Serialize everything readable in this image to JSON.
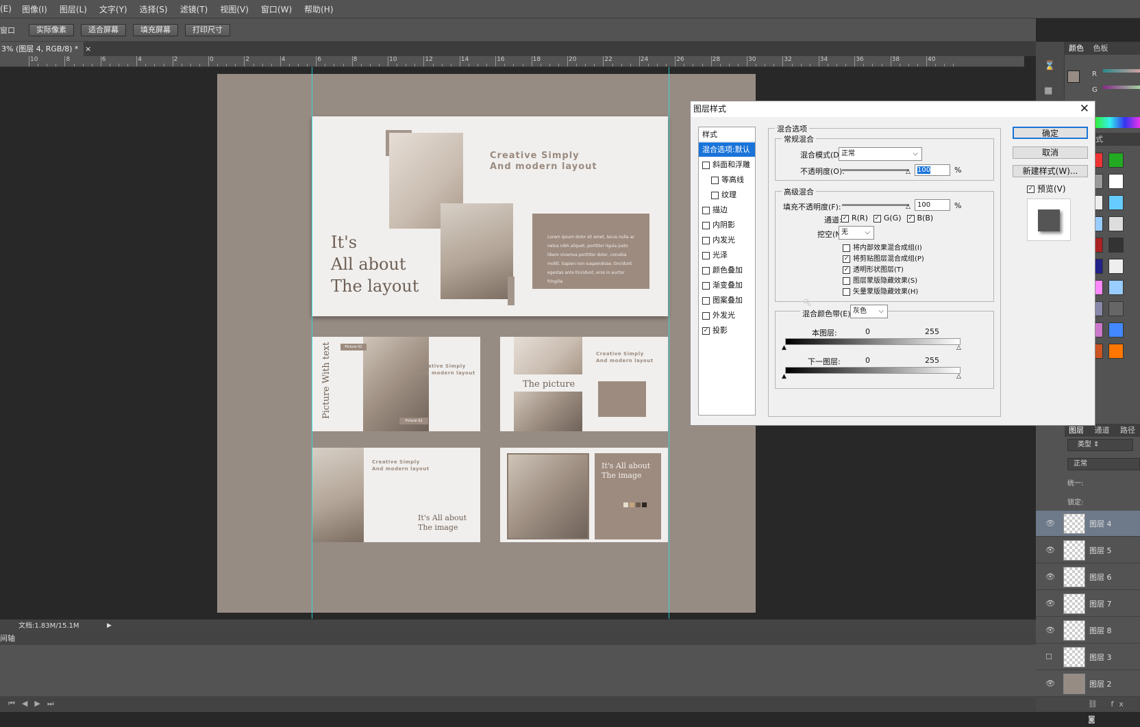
{
  "menu": [
    "(E)",
    "图像(I)",
    "图层(L)",
    "文字(Y)",
    "选择(S)",
    "滤镜(T)",
    "视图(V)",
    "窗口(W)",
    "帮助(H)"
  ],
  "options": {
    "left_label": "窗口",
    "buttons": [
      "实际像素",
      "适合屏幕",
      "填充屏幕",
      "打印尺寸"
    ]
  },
  "doc_tab": "3% (图层 4, RGB/8) *",
  "doc_tab_close": "×",
  "ruler_labels": [
    "10",
    "8",
    "6",
    "4",
    "2",
    "0",
    "2",
    "4",
    "6",
    "8",
    "10",
    "12",
    "14",
    "16",
    "18",
    "20",
    "22",
    "24",
    "26",
    "28",
    "30",
    "32",
    "34",
    "36",
    "38",
    "40"
  ],
  "canvas": {
    "main_slide": {
      "heading": "Creative Simply\nAnd modern layout",
      "title_l1": "It's",
      "title_l2": "All about",
      "title_l3": "The layout",
      "body_bold": "Lorem ipsum dolor sit amet, lacus nulla ac netus nibh aliquet, porttitor ligula justo libero vivamus porttitor dolor, conubia mollit. Sapien non suspendisse, tincidunt egestas ante tincidunt, eros in auctor fringilla"
    },
    "slide2": {
      "vtitle": "Picture With text",
      "tag1": "Picture 01",
      "tag2": "Picture 02",
      "heading": "Creative Simply\nAnd modern layout"
    },
    "slide3": {
      "heading": "Creative Simply\nAnd modern layout",
      "title": "The picture"
    },
    "slide4": {
      "heading": "Creative Simply\nAnd modern layout",
      "title": "It's All about\nThe image"
    },
    "slide5": {
      "title": "It's All about\nThe image"
    }
  },
  "status": {
    "doc_info": "文档:1.83M/15.1M"
  },
  "timeline_label": "间轴",
  "dialog": {
    "title": "图层样式",
    "close": "✕",
    "styles_header": "样式",
    "styles": [
      {
        "label": "混合选项:默认",
        "checkbox": false,
        "selected": true,
        "indent": false
      },
      {
        "label": "斜面和浮雕",
        "checkbox": true,
        "checked": false,
        "indent": false
      },
      {
        "label": "等高线",
        "checkbox": true,
        "checked": false,
        "indent": true
      },
      {
        "label": "纹理",
        "checkbox": true,
        "checked": false,
        "indent": true
      },
      {
        "label": "描边",
        "checkbox": true,
        "checked": false,
        "indent": false
      },
      {
        "label": "内阴影",
        "checkbox": true,
        "checked": false,
        "indent": false
      },
      {
        "label": "内发光",
        "checkbox": true,
        "checked": false,
        "indent": false
      },
      {
        "label": "光泽",
        "checkbox": true,
        "checked": false,
        "indent": false
      },
      {
        "label": "颜色叠加",
        "checkbox": true,
        "checked": false,
        "indent": false
      },
      {
        "label": "渐变叠加",
        "checkbox": true,
        "checked": false,
        "indent": false
      },
      {
        "label": "图案叠加",
        "checkbox": true,
        "checked": false,
        "indent": false
      },
      {
        "label": "外发光",
        "checkbox": true,
        "checked": false,
        "indent": false
      },
      {
        "label": "投影",
        "checkbox": true,
        "checked": true,
        "indent": false
      }
    ],
    "blend_options": "混合选项",
    "general_blending": "常规混合",
    "blend_mode_label": "混合模式(D):",
    "blend_mode_value": "正常",
    "opacity_label": "不透明度(O):",
    "opacity_value": "100",
    "percent": "%",
    "advanced_blending": "高级混合",
    "fill_opacity_label": "填充不透明度(F):",
    "fill_opacity_value": "100",
    "channels_label": "通道:",
    "channels": [
      {
        "label": "R(R)",
        "checked": true
      },
      {
        "label": "G(G)",
        "checked": true
      },
      {
        "label": "B(B)",
        "checked": true
      }
    ],
    "knockout_label": "挖空(N):",
    "knockout_value": "无",
    "adv_options": [
      {
        "label": "将内部效果混合成组(I)",
        "checked": false
      },
      {
        "label": "将剪贴图层混合成组(P)",
        "checked": true
      },
      {
        "label": "透明形状图层(T)",
        "checked": true
      },
      {
        "label": "图层蒙版隐藏效果(S)",
        "checked": false
      },
      {
        "label": "矢量蒙版隐藏效果(H)",
        "checked": false
      }
    ],
    "blend_if_label": "混合颜色带(E):",
    "blend_if_value": "灰色",
    "this_layer_label": "本图层:",
    "underlying_label": "下一图层:",
    "range_low": "0",
    "range_high": "255",
    "ok": "确定",
    "cancel": "取消",
    "new_style": "新建样式(W)...",
    "preview_label": "预览(V)",
    "preview_checked": true
  },
  "right_panel": {
    "color_tabs": [
      "颜色",
      "色板"
    ],
    "channels_rgb": [
      "R",
      "G"
    ],
    "styles_tab": "样式",
    "layer_tabs": [
      "图层",
      "通道",
      "路径"
    ],
    "filter_label": "类型",
    "blend_mode": "正常",
    "unify_label": "统一:",
    "lock_label": "锁定:",
    "layers": [
      {
        "name": "图层 4",
        "visible": true,
        "active": true
      },
      {
        "name": "图层 5",
        "visible": true,
        "active": false
      },
      {
        "name": "图层 6",
        "visible": true,
        "active": false
      },
      {
        "name": "图层 7",
        "visible": true,
        "active": false
      },
      {
        "name": "图层 8",
        "visible": true,
        "active": false
      },
      {
        "name": "图层 3",
        "visible": false,
        "active": false
      },
      {
        "name": "图层 2",
        "visible": true,
        "active": false
      }
    ]
  },
  "colors": {
    "accent": "#1a73d9",
    "doc_bg": "#978c84",
    "guide": "#28e0e0",
    "taupe": "#9d8b80"
  }
}
